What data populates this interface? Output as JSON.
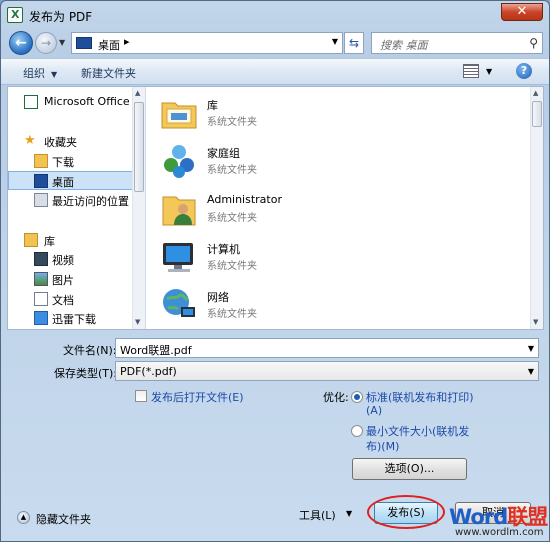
{
  "window": {
    "title": "发布为 PDF",
    "close": "✕"
  },
  "address": {
    "location": "桌面",
    "separator": "▸",
    "search_placeholder": "搜索 桌面"
  },
  "toolbar": {
    "organize": "组织",
    "new_folder": "新建文件夹",
    "help": "?"
  },
  "nav": {
    "items": [
      {
        "label": "Microsoft Office",
        "icon": "excel-icon"
      },
      {
        "label": "收藏夹",
        "icon": "star-icon"
      },
      {
        "label": "下载",
        "icon": "download-folder-icon"
      },
      {
        "label": "桌面",
        "icon": "desktop-icon",
        "selected": true
      },
      {
        "label": "最近访问的位置",
        "icon": "recent-places-icon"
      },
      {
        "label": "库",
        "icon": "library-icon"
      },
      {
        "label": "视频",
        "icon": "video-icon"
      },
      {
        "label": "图片",
        "icon": "pictures-icon"
      },
      {
        "label": "文档",
        "icon": "documents-icon"
      },
      {
        "label": "迅雷下载",
        "icon": "thunder-download-icon"
      }
    ]
  },
  "files": {
    "items": [
      {
        "name": "库",
        "type": "系统文件夹",
        "icon": "library-folder-icon"
      },
      {
        "name": "家庭组",
        "type": "系统文件夹",
        "icon": "homegroup-icon"
      },
      {
        "name": "Administrator",
        "type": "系统文件夹",
        "icon": "user-folder-icon"
      },
      {
        "name": "计算机",
        "type": "系统文件夹",
        "icon": "computer-icon"
      },
      {
        "name": "网络",
        "type": "系统文件夹",
        "icon": "network-icon"
      }
    ]
  },
  "form": {
    "filename_label": "文件名(N):",
    "filename_value": "Word联盟.pdf",
    "savetype_label": "保存类型(T):",
    "savetype_value": "PDF(*.pdf)",
    "open_after_label": "发布后打开文件(E)",
    "optimize_label": "优化:",
    "standard_line1": "标准(联机发布和打印)",
    "standard_line2": "(A)",
    "minimum_line1": "最小文件大小(联机发",
    "minimum_line2": "布)(M)",
    "options_button": "选项(O)..."
  },
  "footer": {
    "hide_folders": "隐藏文件夹",
    "tools": "工具(L)",
    "publish": "发布(S)",
    "cancel": "取消"
  },
  "watermark": {
    "logo_part1": "Word",
    "logo_part2": "联盟",
    "url": "www.wordlm.com"
  },
  "colors": {
    "accent": "#1b49a8",
    "highlight": "#e0201f",
    "selection": "#cce2f7"
  }
}
